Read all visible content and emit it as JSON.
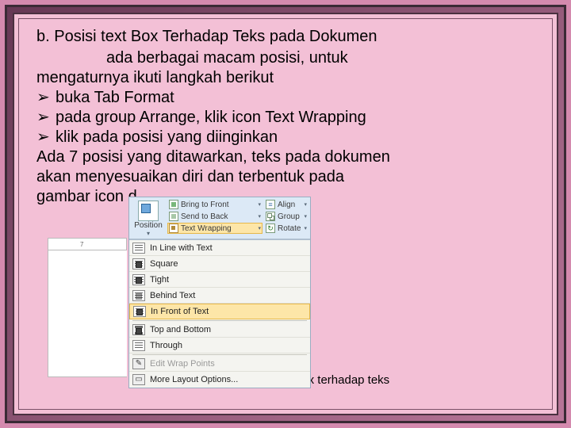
{
  "text": {
    "title": "b. Posisi text Box Terhadap Teks pada Dokumen",
    "p1a": "ada berbagai macam posisi, untuk",
    "p1b": "mengaturnya ikuti langkah berikut",
    "b1": "buka Tab Format",
    "b2": "pada group Arrange, klik icon Text Wrapping",
    "b3": "klik pada posisi yang diinginkan",
    "p2a": "Ada 7 posisi yang ditawarkan, teks pada dokumen",
    "p2b": "akan menyesuaikan diri dan terbentuk pada",
    "p2c": "gambar icon d",
    "caption": "Mengatur posisi Text Box terhadap teks",
    "bullet": "➢"
  },
  "ribbon": {
    "position": "Position",
    "items": {
      "bring_front": "Bring to Front",
      "send_back": "Send to Back",
      "text_wrapping": "Text Wrapping",
      "align": "Align",
      "group": "Group",
      "rotate": "Rotate"
    }
  },
  "menu": {
    "inline": "In Line with Text",
    "square": "Square",
    "tight": "Tight",
    "behind": "Behind Text",
    "front": "In Front of Text",
    "top_bottom": "Top and Bottom",
    "through": "Through",
    "edit": "Edit Wrap Points",
    "more": "More Layout Options..."
  },
  "ruler_mark": "7"
}
